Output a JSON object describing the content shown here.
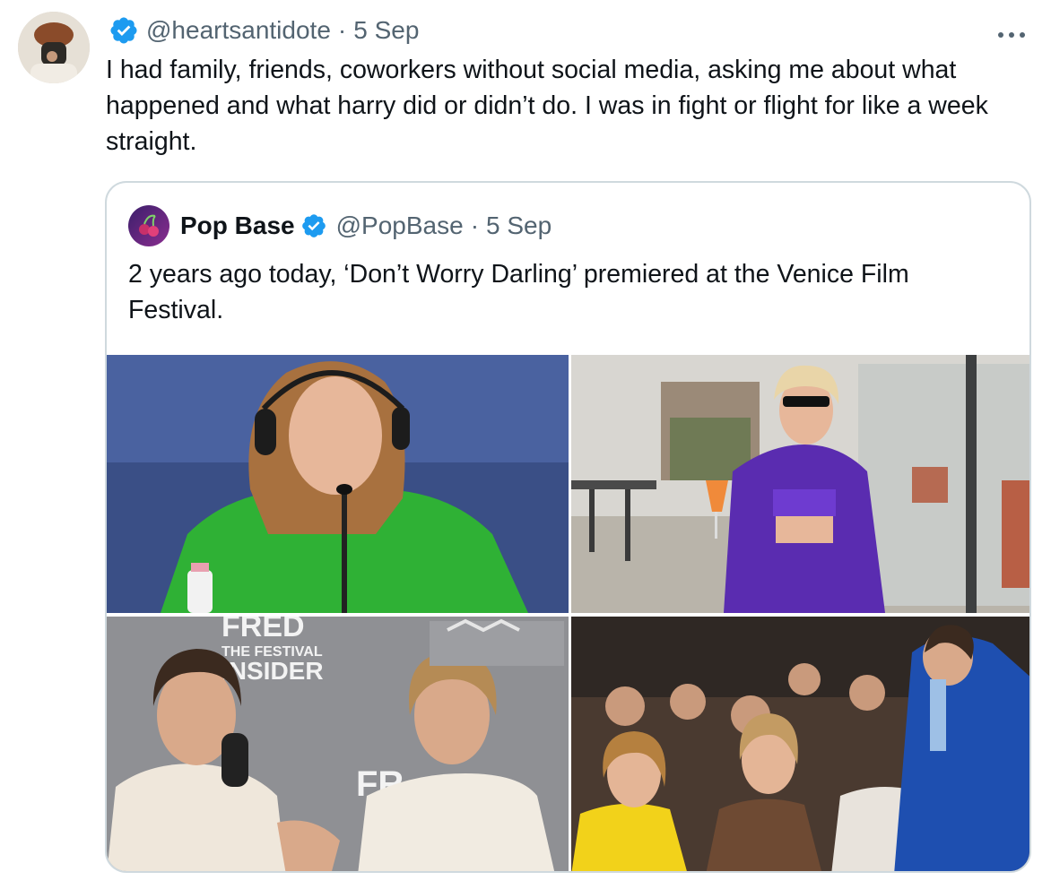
{
  "tweet": {
    "handle": "@heartsantidote",
    "separator": "·",
    "date": "5 Sep",
    "more_icon": "more-icon",
    "text": "I had family, friends, coworkers without social media, asking me about what happened and what harry did or didn’t do. I was in fight or flight for like a week straight."
  },
  "quote": {
    "name": "Pop Base",
    "handle": "@PopBase",
    "separator": "·",
    "date": "5 Sep",
    "text": "2 years ago today, ‘Don’t Worry Darling’ premiered at the Venice Film Festival."
  },
  "media": {
    "photo3_text_1": "FRED",
    "photo3_text_2": "THE FESTIVAL",
    "photo3_text_3": "INSIDER",
    "photo3_text_4": "FR"
  },
  "colors": {
    "verified": "#1d9bf0",
    "secondary_text": "#536471",
    "border": "#cfd9de"
  }
}
